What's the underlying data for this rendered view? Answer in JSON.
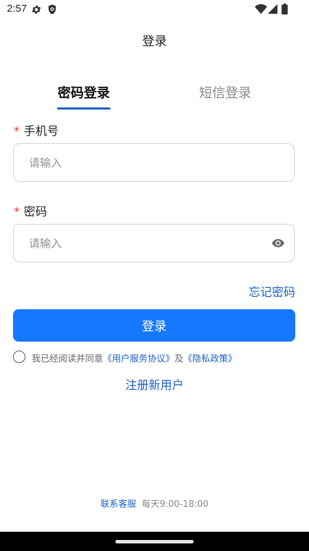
{
  "status_bar": {
    "time": "2:57",
    "icons": [
      "gear-icon",
      "shield-icon",
      "wifi-icon",
      "signal-icon",
      "battery-icon"
    ]
  },
  "header": {
    "title": "登录"
  },
  "tabs": [
    {
      "label": "密码登录",
      "active": true
    },
    {
      "label": "短信登录",
      "active": false
    }
  ],
  "form": {
    "phone": {
      "label": "手机号",
      "required_mark": "*",
      "placeholder": "请输入",
      "value": ""
    },
    "password": {
      "label": "密码",
      "required_mark": "*",
      "placeholder": "请输入",
      "value": "",
      "toggle_icon": "eye-icon"
    },
    "forgot_label": "忘记密码",
    "submit_label": "登录"
  },
  "agreement": {
    "prefix": "我已经阅读并同意",
    "terms_link": "《用户服务协议》",
    "conjunction": "及",
    "privacy_link": "《隐私政策》",
    "checked": false
  },
  "register_label": "注册新用户",
  "footer": {
    "contact_label": "联系客服",
    "hours": "每天9:00-18:00"
  },
  "colors": {
    "primary": "#1677ff",
    "link": "#1b5fc4",
    "required": "#e53935",
    "placeholder": "#8e9297",
    "border": "#cfd3d8"
  }
}
